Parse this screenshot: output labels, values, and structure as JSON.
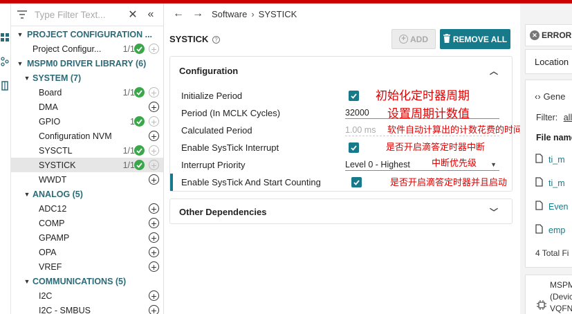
{
  "filter": {
    "placeholder": "Type Filter Text..."
  },
  "tree": {
    "project_configuration": "PROJECT CONFIGURATION ...",
    "project_config_item": "Project Configur...",
    "project_config_count": "1/1",
    "driver_library": "MSPM0 DRIVER LIBRARY (6)",
    "system_group": "SYSTEM (7)",
    "system_items": [
      {
        "label": "Board",
        "count": "1/1",
        "ok": true
      },
      {
        "label": "DMA",
        "count": "",
        "ok": false
      },
      {
        "label": "GPIO",
        "count": "1",
        "ok": true
      },
      {
        "label": "Configuration NVM",
        "count": "",
        "ok": false
      },
      {
        "label": "SYSCTL",
        "count": "1/1",
        "ok": true
      },
      {
        "label": "SYSTICK",
        "count": "1/1",
        "ok": true
      },
      {
        "label": "WWDT",
        "count": "",
        "ok": false
      }
    ],
    "analog_group": "ANALOG (5)",
    "analog_items": [
      "ADC12",
      "COMP",
      "GPAMP",
      "OPA",
      "VREF"
    ],
    "comm_group": "COMMUNICATIONS (5)",
    "comm_items": [
      "I2C",
      "I2C - SMBUS"
    ]
  },
  "breadcrumb": {
    "root": "Software",
    "sep": "›",
    "current": "SYSTICK"
  },
  "module": {
    "title": "SYSTICK",
    "add_label": "ADD",
    "remove_label": "REMOVE ALL"
  },
  "config": {
    "header": "Configuration",
    "rows": [
      {
        "label": "Initialize Period",
        "type": "checkbox",
        "checked": true
      },
      {
        "label": "Period (In MCLK Cycles)",
        "type": "input",
        "value": "32000"
      },
      {
        "label": "Calculated Period",
        "type": "readonly",
        "value": "1.00 ms"
      },
      {
        "label": "Enable SysTick Interrupt",
        "type": "checkbox",
        "checked": true
      },
      {
        "label": "Interrupt Priority",
        "type": "select",
        "value": "Level 0 - Highest"
      },
      {
        "label": "Enable SysTick And Start Counting",
        "type": "checkbox",
        "checked": true
      }
    ]
  },
  "other_deps": {
    "header": "Other Dependencies"
  },
  "annotations": [
    "初始化定时器周期",
    "设置周期计数值",
    "软件自动计算出的计数花费的时间",
    "是否开启滴答定时器中断",
    "中断优先级",
    "是否开启滴答定时器并且启动"
  ],
  "right_panel": {
    "errors_label": "ERRORS",
    "location_label": "Location",
    "generated_label": "Gene",
    "filter_label": "Filter:",
    "filter_value": "all",
    "file_name_header": "File name",
    "files": [
      "ti_m",
      "ti_m",
      "Even",
      "emp"
    ],
    "total_label": "4 Total Fi",
    "device_lines": [
      "MSPM",
      "(Devic",
      "VQFN"
    ]
  },
  "colors": {
    "accent": "#177a8a",
    "success": "#3aa84a",
    "annotation": "#e00000",
    "topbar": "#cc0000"
  }
}
